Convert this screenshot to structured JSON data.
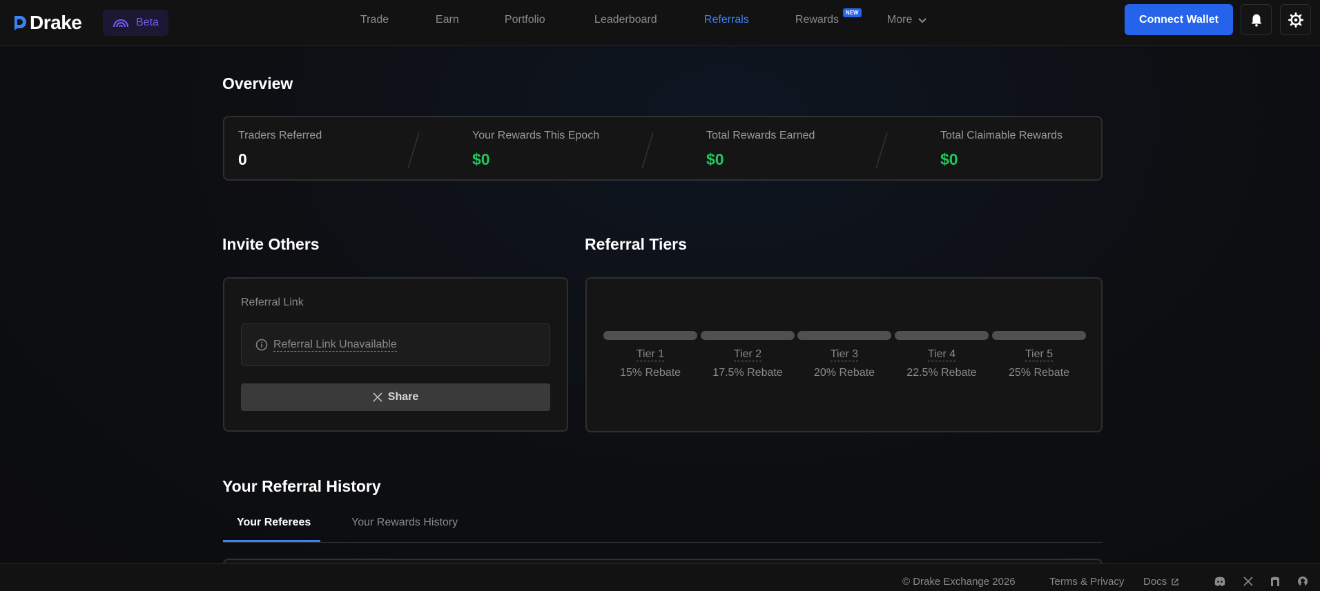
{
  "header": {
    "logo_text": "Drake",
    "beta_label": "Beta",
    "nav": [
      {
        "label": "Trade"
      },
      {
        "label": "Earn"
      },
      {
        "label": "Portfolio"
      },
      {
        "label": "Leaderboard"
      },
      {
        "label": "Referrals",
        "active": true
      },
      {
        "label": "Rewards",
        "badge": "NEW"
      },
      {
        "label": "More"
      }
    ],
    "connect_wallet_label": "Connect Wallet",
    "icons": [
      "bell-icon",
      "gear-icon"
    ]
  },
  "overview": {
    "title": "Overview",
    "stats": [
      {
        "label": "Traders Referred",
        "value": "0"
      },
      {
        "label": "Your Rewards This Epoch",
        "value": "$0"
      },
      {
        "label": "Total Rewards Earned",
        "value": "$0"
      },
      {
        "label": "Total Claimable Rewards",
        "value": "$0"
      }
    ]
  },
  "invite": {
    "title": "Invite Others",
    "referral_link_label": "Referral Link",
    "referral_link_value": "Referral Link Unavailable",
    "share_label": "Share"
  },
  "tiers": {
    "title": "Referral Tiers",
    "items": [
      {
        "name": "Tier 1",
        "rebate": "15% Rebate"
      },
      {
        "name": "Tier 2",
        "rebate": "17.5% Rebate"
      },
      {
        "name": "Tier 3",
        "rebate": "20% Rebate"
      },
      {
        "name": "Tier 4",
        "rebate": "22.5% Rebate"
      },
      {
        "name": "Tier 5",
        "rebate": "25% Rebate"
      }
    ]
  },
  "history": {
    "title": "Your Referral History",
    "tabs": [
      {
        "label": "Your Referees",
        "active": true
      },
      {
        "label": "Your Rewards History"
      }
    ]
  },
  "footer": {
    "copyright": "© Drake Exchange 2026",
    "terms_label": "Terms & Privacy",
    "docs_label": "Docs",
    "social_icons": [
      "discord-icon",
      "x-icon",
      "gitbook-icon",
      "github-icon"
    ]
  },
  "colors": {
    "accent": "#2563eb",
    "link_active": "#3b82f6",
    "positive": "#22c55e",
    "beta": "#7b5cf5"
  }
}
